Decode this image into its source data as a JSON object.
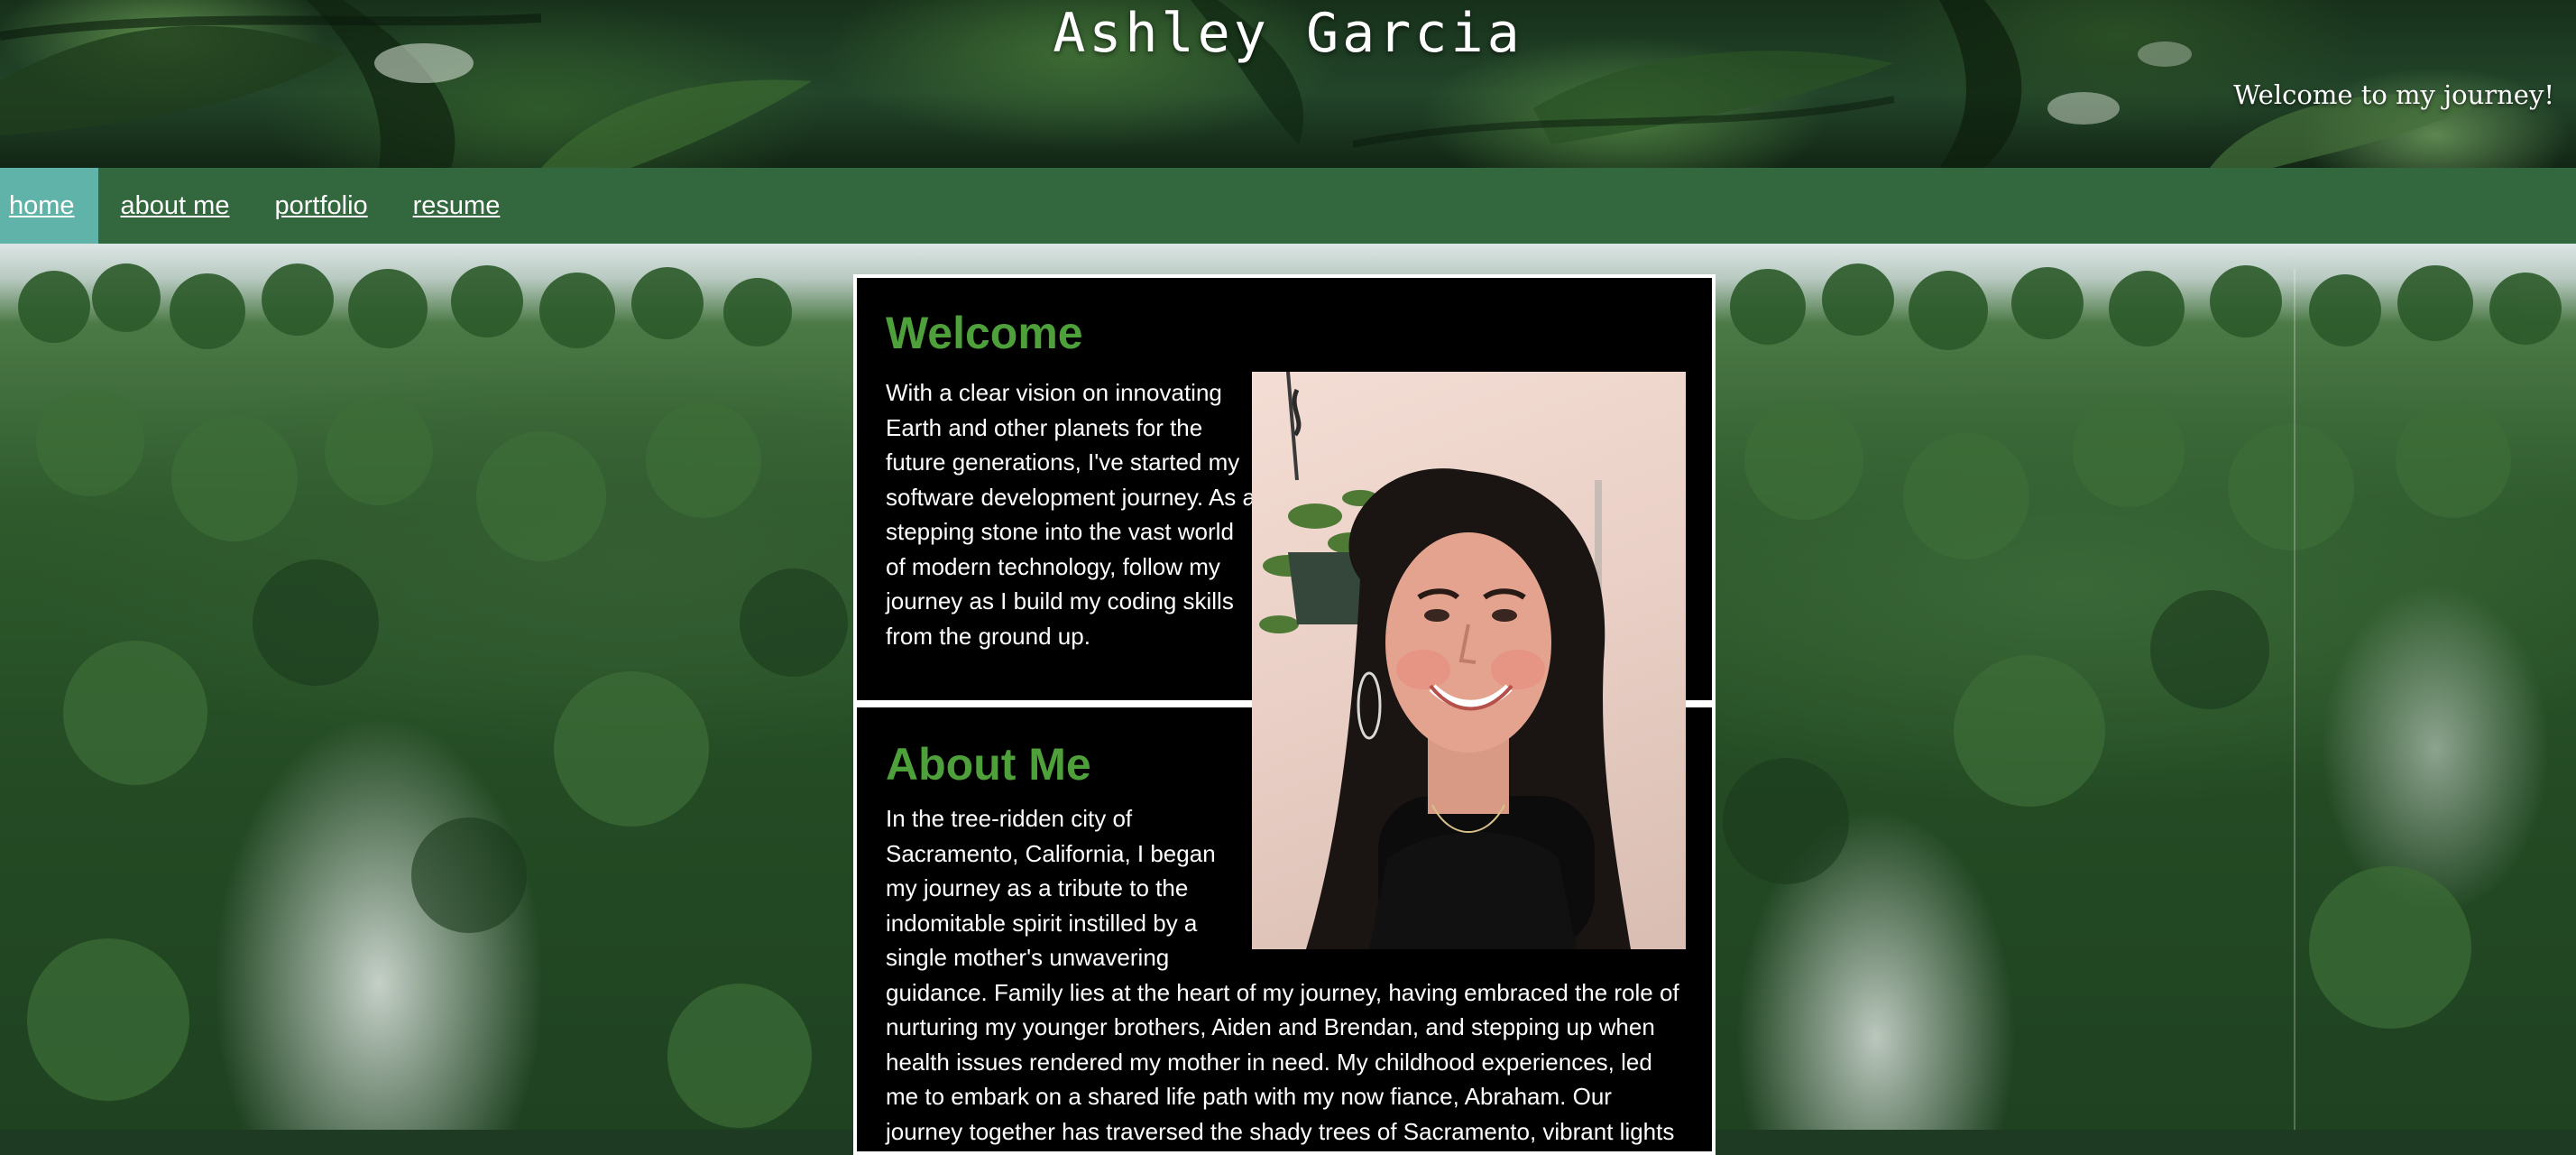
{
  "header": {
    "site_title": "Ashley Garcia",
    "tagline": "Welcome to my journey!"
  },
  "nav": {
    "items": [
      {
        "label": "home",
        "active": true
      },
      {
        "label": "about me",
        "active": false
      },
      {
        "label": "portfolio",
        "active": false
      },
      {
        "label": "resume",
        "active": false
      }
    ]
  },
  "welcome": {
    "heading": "Welcome",
    "text": "With a clear vision on innovating Earth and other planets for the future generations, I've started my software development journey. As a stepping stone into the vast world of modern technology, follow my journey as I build my coding skills from the ground up."
  },
  "about": {
    "heading": "About Me",
    "text": "In the tree-ridden city of Sacramento, California, I began my journey as a tribute to the indomitable spirit instilled by a single mother's unwavering guidance. Family lies at the heart of my journey, having embraced the role of nurturing my younger brothers, Aiden and Brendan, and stepping up when health issues rendered my mother in need. My childhood experiences, led me to embark on a shared life path with my now fiance, Abraham. Our journey together has traversed the shady trees of Sacramento, vibrant lights"
  },
  "colors": {
    "nav_bg": "#33673d",
    "nav_active_bg": "#5fb3a8",
    "heading_green": "#4ea03a",
    "panel_bg": "#000000"
  }
}
